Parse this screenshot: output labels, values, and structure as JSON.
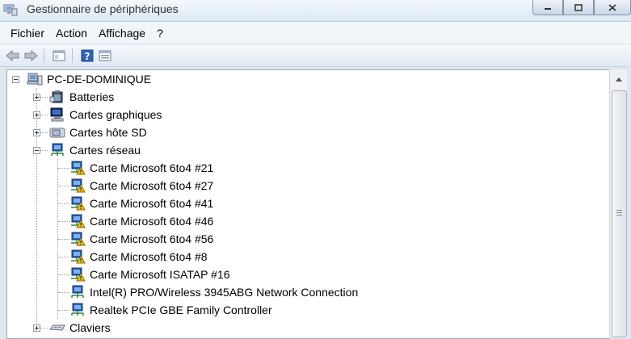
{
  "window": {
    "title": "Gestionnaire de périphériques"
  },
  "menu": [
    "Fichier",
    "Action",
    "Affichage",
    "?"
  ],
  "toolbar": {
    "buttons": [
      "back-icon",
      "forward-icon",
      "show-hide-tree-icon",
      "help-icon",
      "properties-icon"
    ]
  },
  "tree": {
    "root": "PC-DE-DOMINIQUE",
    "categories": {
      "batteries": "Batteries",
      "cartes_graphiques": "Cartes graphiques",
      "cartes_hote_sd": "Cartes hôte SD",
      "cartes_reseau": "Cartes réseau",
      "claviers": "Claviers"
    },
    "network_adapters": [
      {
        "label": "Carte Microsoft 6to4 #21",
        "warning": true
      },
      {
        "label": "Carte Microsoft 6to4 #27",
        "warning": true
      },
      {
        "label": "Carte Microsoft 6to4 #41",
        "warning": true
      },
      {
        "label": "Carte Microsoft 6to4 #46",
        "warning": true
      },
      {
        "label": "Carte Microsoft 6to4 #56",
        "warning": true
      },
      {
        "label": "Carte Microsoft 6to4 #8",
        "warning": true
      },
      {
        "label": "Carte Microsoft ISATAP #16",
        "warning": true
      },
      {
        "label": "Intel(R) PRO/Wireless 3945ABG Network Connection",
        "warning": false
      },
      {
        "label": "Realtek PCIe GBE Family Controller",
        "warning": false
      }
    ]
  },
  "colors": {
    "warning": "#f5c400",
    "network_blue": "#2a5fb0",
    "selection_frame": "#9aa9ba"
  }
}
